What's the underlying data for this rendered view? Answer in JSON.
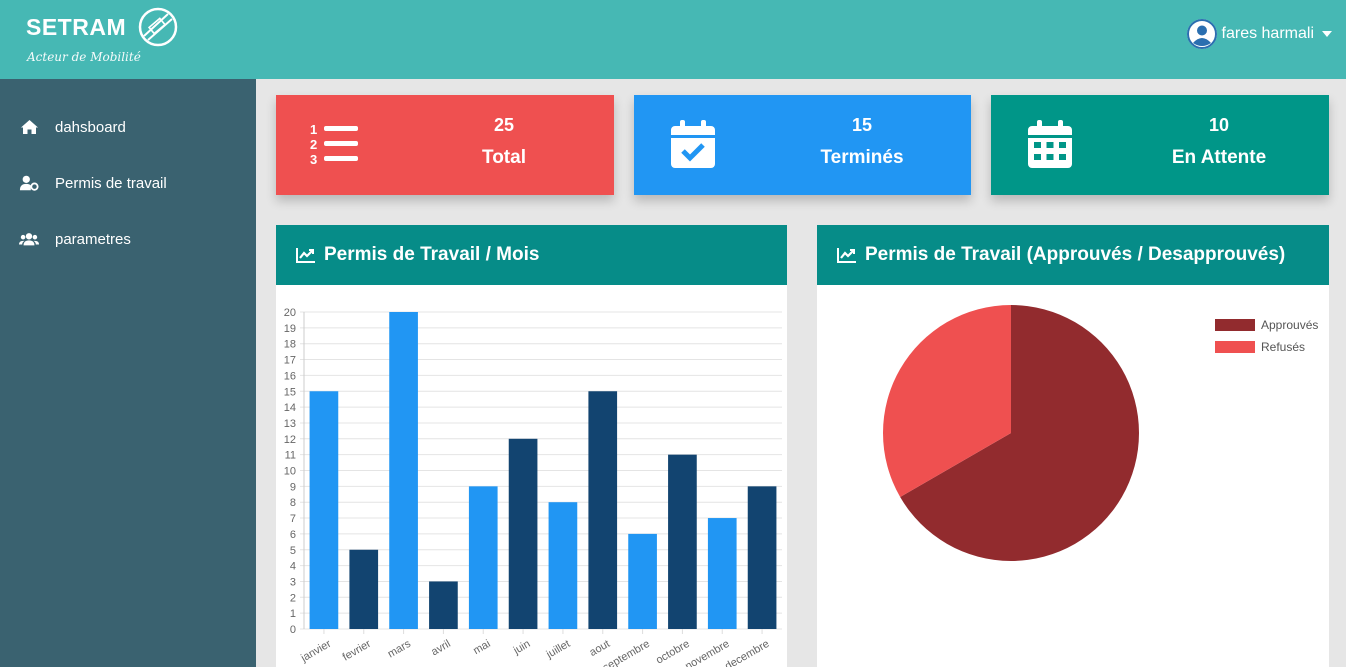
{
  "header": {
    "logo_text": "SETRAM",
    "tagline": "Acteur de Mobilité",
    "user_name": "fares harmali"
  },
  "sidebar": {
    "items": [
      {
        "label": "dahsboard",
        "icon": "home-icon"
      },
      {
        "label": "Permis de travail",
        "icon": "user-cog-icon"
      },
      {
        "label": "parametres",
        "icon": "users-icon"
      }
    ]
  },
  "stats": [
    {
      "value": "25",
      "label": "Total",
      "icon": "list-ol-icon",
      "color": "#ef5050"
    },
    {
      "value": "15",
      "label": "Terminés",
      "icon": "calendar-check-icon",
      "color": "#2196f3"
    },
    {
      "value": "10",
      "label": "En Attente",
      "icon": "calendar-icon",
      "color": "#009688"
    }
  ],
  "panels": {
    "bar_title": "Permis de Travail / Mois",
    "pie_title": "Permis de Travail (Approuvés / Desapprouvés)"
  },
  "colors": {
    "header": "#46b8b4",
    "sidebar": "#3a6270",
    "panel_header": "#068c88",
    "bar_light": "#2196f3",
    "bar_dark": "#124470",
    "pie_approved": "#922b2e",
    "pie_refused": "#ef5050"
  },
  "chart_data": [
    {
      "type": "bar",
      "categories": [
        "janvier",
        "fevrier",
        "mars",
        "avril",
        "mai",
        "juin",
        "juillet",
        "aout",
        "septembre",
        "octobre",
        "novembre",
        "decembre"
      ],
      "values": [
        15,
        5,
        20,
        3,
        9,
        12,
        8,
        15,
        6,
        11,
        7,
        9
      ],
      "ylim": [
        0,
        20
      ],
      "yticks_step": 1,
      "grid": true,
      "legend": "none"
    },
    {
      "type": "pie",
      "labels": [
        "Approuvés",
        "Refusés"
      ],
      "values": [
        2,
        1
      ],
      "legend": "top-right"
    }
  ]
}
